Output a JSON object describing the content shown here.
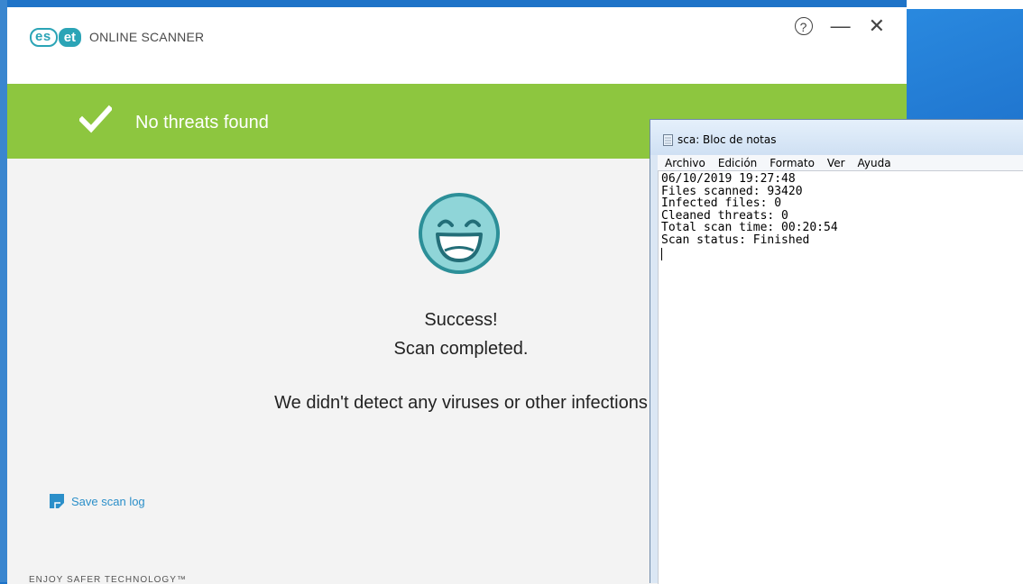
{
  "eset": {
    "logo_mark_left": "es",
    "logo_mark_right": "et",
    "logo_text": "ONLINE SCANNER",
    "controls": {
      "help": "?",
      "minimize": "—",
      "close": "✕"
    },
    "banner_text": "No threats found",
    "success": "Success!",
    "completed": "Scan completed.",
    "detail": "We didn't detect any viruses or other infections",
    "save_log": "Save scan log",
    "footer": "ENJOY SAFER TECHNOLOGY™",
    "colors": {
      "banner": "#8dc63f",
      "brand": "#2ba4b6",
      "smiley": "#2c9aa4"
    },
    "icons": [
      "check-icon",
      "smiley-icon",
      "help-icon",
      "minimize-icon",
      "close-icon",
      "save-icon"
    ]
  },
  "notepad": {
    "title": "sca: Bloc de notas",
    "menu": [
      "Archivo",
      "Edición",
      "Formato",
      "Ver",
      "Ayuda"
    ],
    "content": "06/10/2019 19:27:48\nFiles scanned: 93420\nInfected files: 0\nCleaned threats: 0\nTotal scan time: 00:20:54\nScan status: Finished"
  }
}
